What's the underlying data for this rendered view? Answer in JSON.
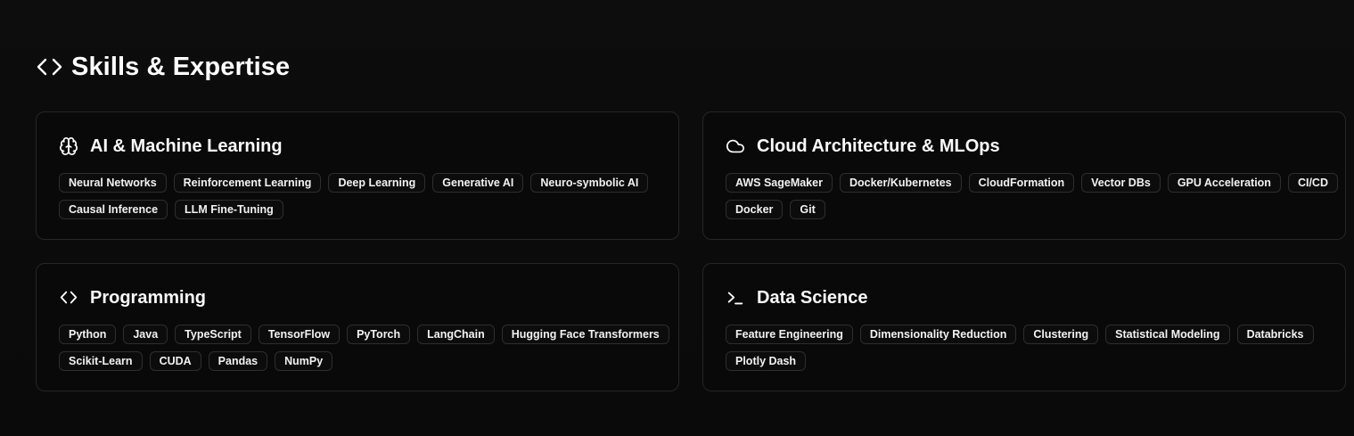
{
  "section": {
    "title": "Skills & Expertise",
    "icon": "code-icon"
  },
  "cards": [
    {
      "title": "AI & Machine Learning",
      "icon": "brain-icon",
      "tags": [
        "Neural Networks",
        "Reinforcement Learning",
        "Deep Learning",
        "Generative AI",
        "Neuro-symbolic AI",
        "Causal Inference",
        "LLM Fine-Tuning"
      ]
    },
    {
      "title": "Cloud Architecture & MLOps",
      "icon": "cloud-icon",
      "tags": [
        "AWS SageMaker",
        "Docker/Kubernetes",
        "CloudFormation",
        "Vector DBs",
        "GPU Acceleration",
        "CI/CD",
        "Docker",
        "Git"
      ]
    },
    {
      "title": "Programming",
      "icon": "code-icon",
      "tags": [
        "Python",
        "Java",
        "TypeScript",
        "TensorFlow",
        "PyTorch",
        "LangChain",
        "Hugging Face Transformers",
        "Scikit-Learn",
        "CUDA",
        "Pandas",
        "NumPy"
      ]
    },
    {
      "title": "Data Science",
      "icon": "terminal-icon",
      "tags": [
        "Feature Engineering",
        "Dimensionality Reduction",
        "Clustering",
        "Statistical Modeling",
        "Databricks",
        "Plotly Dash"
      ]
    }
  ]
}
